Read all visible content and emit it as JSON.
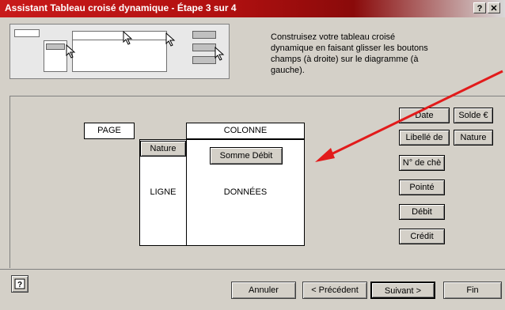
{
  "window": {
    "title": "Assistant Tableau croisé dynamique - Étape 3 sur 4",
    "help_glyph": "?",
    "close_glyph": "✕"
  },
  "instructions": "Construisez votre tableau croisé dynamique en faisant glisser les boutons champs (à droite) sur le diagramme (à gauche).",
  "layout": {
    "page_label": "PAGE",
    "column_label": "COLONNE",
    "row_label": "LIGNE",
    "data_label": "DONNÉES",
    "row_field": "Nature",
    "data_field": "Somme Débit"
  },
  "fields": [
    {
      "label": "Date"
    },
    {
      "label": "Solde €"
    },
    {
      "label": "Libellé de"
    },
    {
      "label": "Nature"
    },
    {
      "label": "N° de chè"
    },
    {
      "label": "Pointé"
    },
    {
      "label": "Débit"
    },
    {
      "label": "Crédit"
    }
  ],
  "footer": {
    "cancel": "Annuler",
    "previous": "< Précédent",
    "next": "Suivant >",
    "finish": "Fin"
  },
  "colors": {
    "accent": "#e21b1b",
    "face": "#d4d0c8"
  },
  "icons": [
    "help-icon",
    "cursor-arrow-icon",
    "red-arrow-icon"
  ]
}
